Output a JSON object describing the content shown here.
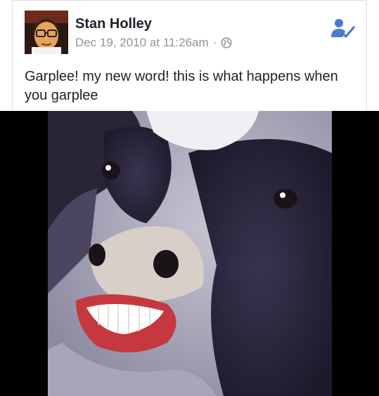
{
  "post": {
    "author": "Stan Holley",
    "timestamp": "Dec 19, 2010 at 11:26am",
    "separator": "·",
    "privacy_icon": "globe-icon",
    "action_icon": "add-friend-icon",
    "text": "Garplee! my new word! this is what happens when you garplee"
  },
  "avatar": {
    "icon": "cartoon-man-with-glasses-avatar"
  },
  "photo": {
    "subject": "cow-with-human-smile-photo"
  },
  "colors": {
    "name": "#1d2129",
    "meta": "#90949c",
    "accent": "#4a7bd0",
    "media_bg": "#000000"
  }
}
